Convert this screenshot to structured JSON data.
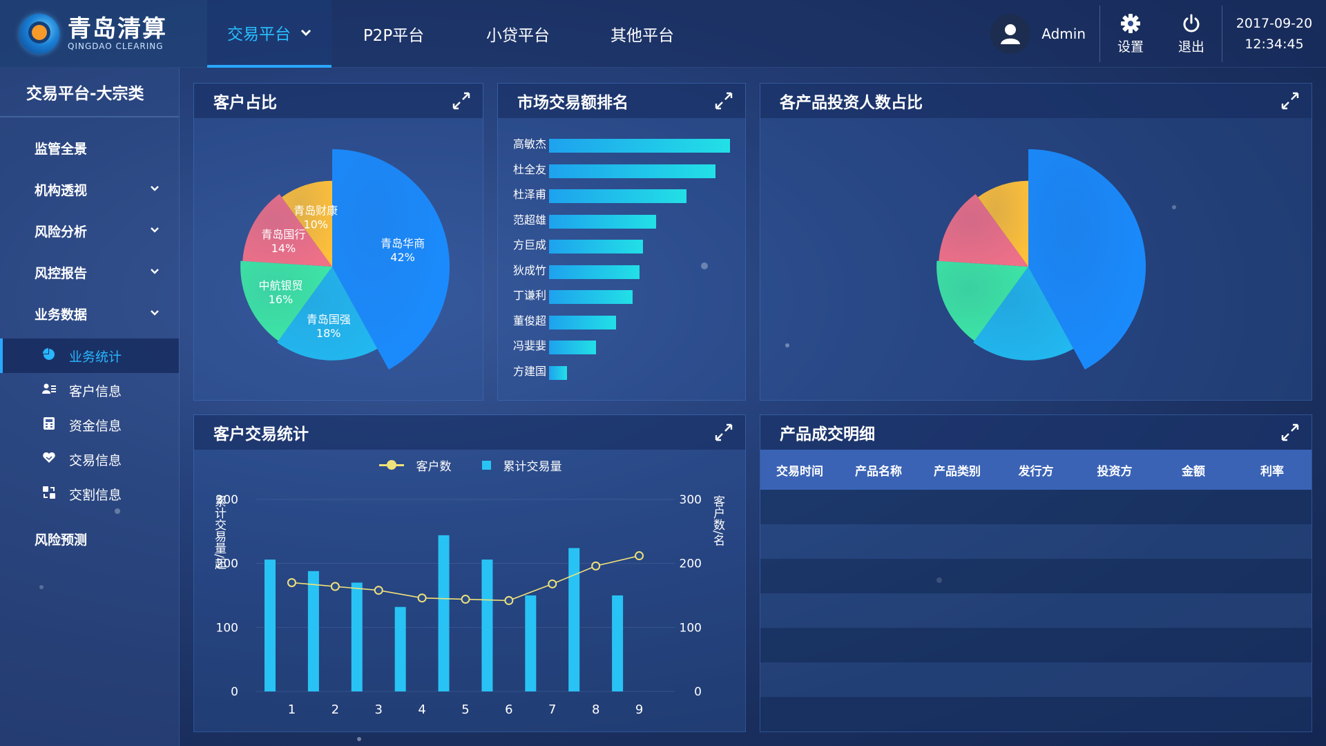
{
  "logo": {
    "title": "青岛清算",
    "subtitle": "QINGDAO CLEARING"
  },
  "nav": {
    "items": [
      {
        "label": "交易平台"
      },
      {
        "label": "P2P平台"
      },
      {
        "label": "小贷平台"
      },
      {
        "label": "其他平台"
      }
    ],
    "active_index": 0
  },
  "user": {
    "name": "Admin"
  },
  "tools": {
    "settings_label": "设置",
    "logout_label": "退出"
  },
  "datetime": {
    "date": "2017-09-20",
    "time": "12:34:45"
  },
  "sidebar": {
    "title": "交易平台-大宗类",
    "items": [
      {
        "label": "监管全景"
      },
      {
        "label": "机构透视"
      },
      {
        "label": "风险分析"
      },
      {
        "label": "风控报告"
      },
      {
        "label": "业务数据"
      }
    ],
    "sub_items": [
      {
        "label": "业务统计",
        "icon": "pie-chart-icon",
        "active": true
      },
      {
        "label": "客户信息",
        "icon": "user-list-icon"
      },
      {
        "label": "资金信息",
        "icon": "calculator-icon"
      },
      {
        "label": "交易信息",
        "icon": "handshake-icon"
      },
      {
        "label": "交割信息",
        "icon": "exchange-icon"
      }
    ],
    "footer_item": {
      "label": "风险预测"
    }
  },
  "panels": {
    "customer_share": {
      "title": "客户占比"
    },
    "market_rank": {
      "title": "市场交易额排名"
    },
    "product_investors": {
      "title": "各产品投资人数占比"
    },
    "customer_trade": {
      "title": "客户交易统计"
    },
    "product_detail": {
      "title": "产品成交明细"
    }
  },
  "product_table": {
    "columns": [
      "交易时间",
      "产品名称",
      "产品类别",
      "发行方",
      "投资方",
      "金额",
      "利率"
    ],
    "rows": []
  },
  "chart_data": [
    {
      "id": "customer_share",
      "type": "pie",
      "labels": [
        "青岛华商",
        "青岛国强",
        "中航银贸",
        "青岛国行",
        "青岛财康"
      ],
      "values": [
        42,
        18,
        16,
        14,
        10
      ],
      "value_labels": [
        "42%",
        "18%",
        "16%",
        "14%",
        "10%"
      ],
      "colors": [
        "#1a8cff",
        "#22b8f0",
        "#3ee8a6",
        "#f07088",
        "#ffc03a"
      ]
    },
    {
      "id": "market_rank",
      "type": "bar",
      "orientation": "horizontal",
      "categories": [
        "高敏杰",
        "杜全友",
        "杜泽甫",
        "范超雄",
        "方巨成",
        "狄成竹",
        "丁谦利",
        "董俊超",
        "冯婓婓",
        "方建国"
      ],
      "values": [
        100,
        92,
        76,
        59,
        52,
        50,
        46,
        37,
        26,
        10
      ]
    },
    {
      "id": "product_investors",
      "type": "pie",
      "values": [
        42,
        18,
        16,
        14,
        10
      ],
      "colors": [
        "#1a8cff",
        "#22b8f0",
        "#3ee8a6",
        "#f07088",
        "#ffc03a"
      ]
    },
    {
      "id": "customer_trade",
      "type": "bar",
      "categories": [
        "1",
        "2",
        "3",
        "4",
        "5",
        "6",
        "7",
        "8",
        "9"
      ],
      "series": [
        {
          "name": "累计交易量",
          "type": "bar",
          "values": [
            206,
            188,
            170,
            132,
            244,
            206,
            150,
            224,
            150
          ],
          "color": "#28c3f4"
        },
        {
          "name": "客户数",
          "type": "line",
          "values": [
            170,
            164,
            158,
            146,
            144,
            142,
            168,
            196,
            212
          ],
          "color": "#f0e27a"
        }
      ],
      "bar_offset": -0.5,
      "y_left": {
        "label": "累计交易量/起",
        "ticks": [
          0,
          100,
          200,
          300
        ],
        "range": [
          0,
          300
        ]
      },
      "y_right": {
        "label": "客户数/名",
        "ticks": [
          0,
          100,
          200,
          300
        ],
        "range": [
          0,
          300
        ]
      }
    }
  ]
}
